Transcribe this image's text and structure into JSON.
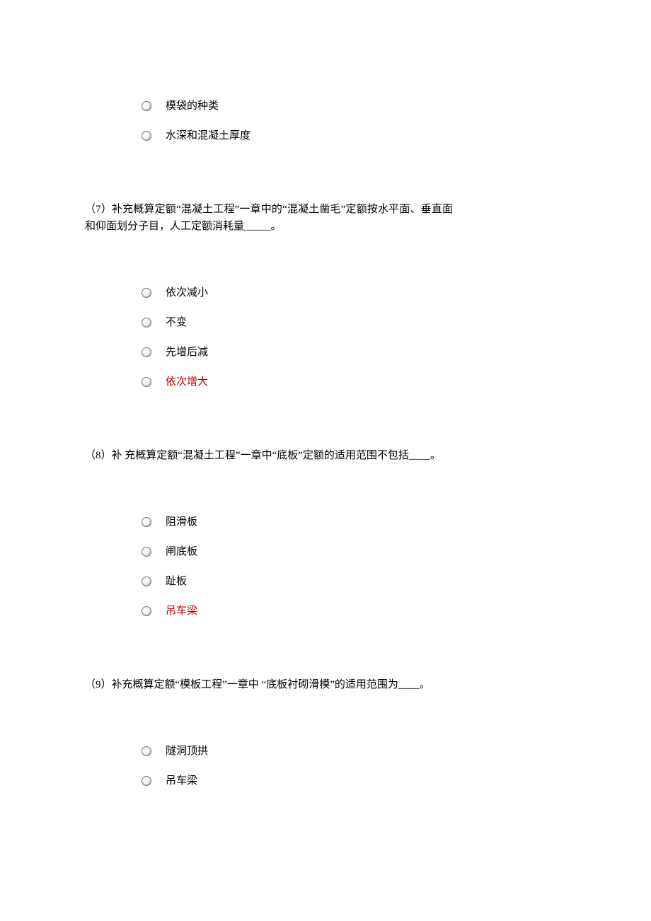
{
  "leading_options": [
    {
      "label": "模袋的种类",
      "highlight": false
    },
    {
      "label": "水深和混凝土厚度",
      "highlight": false
    }
  ],
  "questions": [
    {
      "prompt": "（7）补充概算定额“混凝土工程”一章中的“混凝土凿毛”定额按水平面、垂直面和仰面划分子目，人工定额消耗量_____。",
      "options": [
        {
          "label": "依次减小",
          "highlight": false
        },
        {
          "label": "不变",
          "highlight": false
        },
        {
          "label": "先增后减",
          "highlight": false
        },
        {
          "label": "依次增大",
          "highlight": true
        }
      ]
    },
    {
      "prompt": "（8）补 充概算定额“混凝土工程”一章中“底板”定额的适用范围不包括____。",
      "options": [
        {
          "label": "阻滑板",
          "highlight": false
        },
        {
          "label": "闸底板",
          "highlight": false
        },
        {
          "label": "趾板",
          "highlight": false
        },
        {
          "label": "吊车梁",
          "highlight": true
        }
      ]
    },
    {
      "prompt": "（9）补充概算定额“模板工程”一章中 “底板衬砌滑模”的适用范围为____。",
      "options": [
        {
          "label": "隧洞顶拱",
          "highlight": false
        },
        {
          "label": "吊车梁",
          "highlight": false
        }
      ]
    }
  ]
}
